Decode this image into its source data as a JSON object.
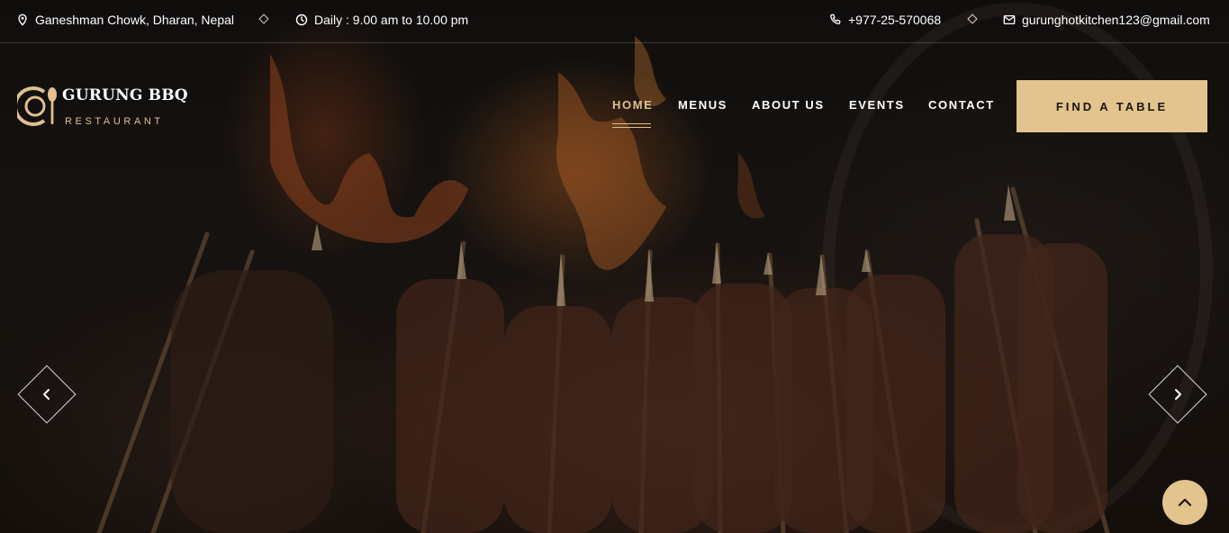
{
  "topbar": {
    "address": "Ganeshman Chowk, Dharan, Nepal",
    "hours": "Daily : 9.00 am to 10.00 pm",
    "phone": "+977-25-570068",
    "email": "gurunghotkitchen123@gmail.com"
  },
  "brand": {
    "title": "GURUNG BBQ",
    "subtitle": "RESTAURANT"
  },
  "nav": {
    "items": [
      {
        "label": "HOME",
        "active": true
      },
      {
        "label": "MENUS",
        "active": false
      },
      {
        "label": "ABOUT US",
        "active": false
      },
      {
        "label": "EVENTS",
        "active": false
      },
      {
        "label": "CONTACT",
        "active": false
      }
    ],
    "cta": "FIND A TABLE"
  },
  "icons": {
    "address": "map-pin-icon",
    "hours": "clock-icon",
    "phone": "phone-icon",
    "email": "mail-icon",
    "prev": "chevron-left-icon",
    "next": "chevron-right-icon",
    "back_to_top": "chevron-up-icon"
  },
  "colors": {
    "accent": "#e3c48e",
    "accent_text": "#e0c08e",
    "hero_overlay": "#0d0c0a"
  }
}
